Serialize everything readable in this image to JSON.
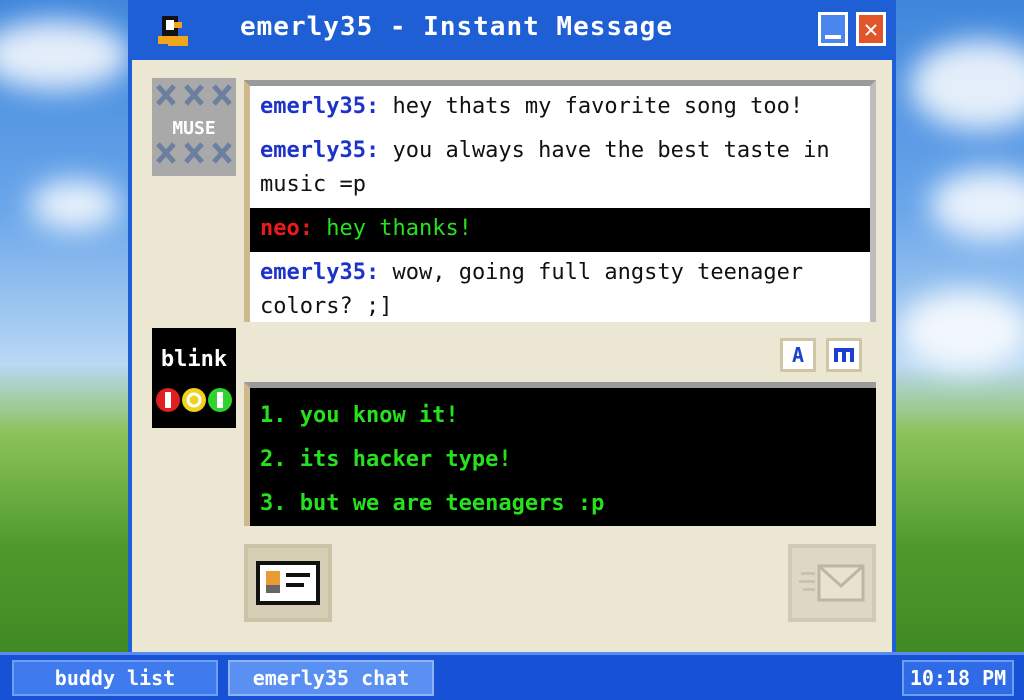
{
  "window": {
    "title": "emerly35 - Instant Message",
    "icon": "buddy-icon",
    "minimize_icon": "minimize-icon",
    "close_icon": "close-icon"
  },
  "avatars": {
    "top_label": "MUSE",
    "bottom_label": "blink",
    "bottom_logo_digits": "101"
  },
  "chat": {
    "messages": [
      {
        "sender": "emerly35:",
        "text": "hey thats my favorite song too!"
      },
      {
        "sender": "emerly35:",
        "text": "you always have the best taste in music =p"
      },
      {
        "sender": "neo:",
        "text": "hey thanks!"
      },
      {
        "sender": "emerly35:",
        "text": "wow, going full angsty teenager colors? ;]"
      }
    ]
  },
  "format_buttons": {
    "font_label": "A",
    "font_b_icon": "font-style-icon"
  },
  "compose": {
    "lines": [
      "1. you know it!",
      "2. its hacker type!",
      "3. but we are teenagers :p"
    ]
  },
  "actions": {
    "profile_icon": "profile-card-icon",
    "send_icon": "send-envelope-icon"
  },
  "taskbar": {
    "items": [
      "buddy list",
      "emerly35 chat"
    ],
    "clock": "10:18 PM"
  },
  "colors": {
    "title_bar": "#1f5fd6",
    "self_name": "#1d33c8",
    "other_name": "#ee1a1a",
    "hacker_green": "#27e11e"
  }
}
